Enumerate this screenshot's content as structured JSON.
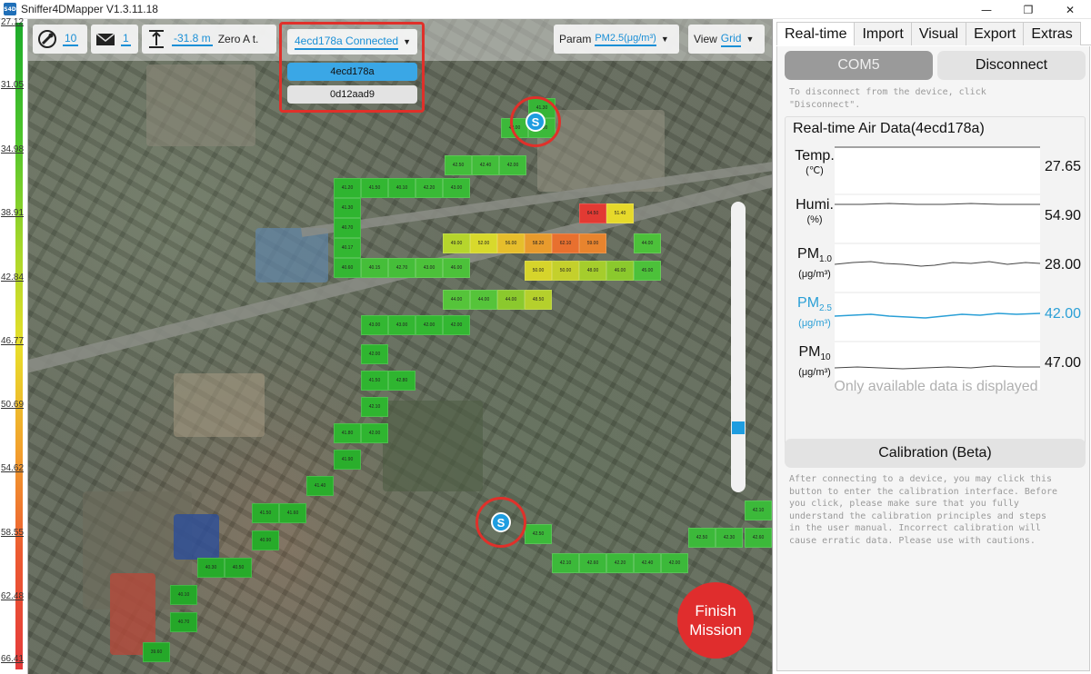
{
  "window": {
    "title": "Sniffer4DMapper V1.3.11.18",
    "icon_text": "S4D",
    "min": "—",
    "max": "❐",
    "close": "✕"
  },
  "scale": {
    "labels": [
      "27.12",
      "31.05",
      "34.98",
      "38.91",
      "42.84",
      "46.77",
      "50.69",
      "54.62",
      "58.55",
      "62.48",
      "66.41"
    ]
  },
  "toolbar": {
    "satellites": "10",
    "messages": "1",
    "altitude": "-31.8 m",
    "zero_label": "Zero A t.",
    "device_selected": "4ecd178a Connected",
    "device_options": [
      "4ecd178a",
      "0d12aad9"
    ],
    "param_label": "Param",
    "param_value": "PM2.5(μg/m³)",
    "view_label": "View",
    "view_value": "Grid"
  },
  "markers": [
    "S",
    "S"
  ],
  "finish_button": "Finish Mission",
  "panel": {
    "tabs": [
      "Real-time",
      "Import",
      "Visual",
      "Export",
      "Extras"
    ],
    "active_tab": "Real-time",
    "port_button": "COM5",
    "disconnect_button": "Disconnect",
    "disconnect_hint": [
      "To disconnect from the device, click",
      "\"Disconnect\"."
    ],
    "air_title": "Real-time Air Data(4ecd178a)",
    "rows": [
      {
        "label": "Temp.",
        "unit": "(℃)",
        "value": "27.65"
      },
      {
        "label": "Humi.",
        "unit": "(%)",
        "value": "54.90"
      },
      {
        "label": "PM",
        "sub": "1.0",
        "unit": "(μg/m³)",
        "value": "28.00"
      },
      {
        "label": "PM",
        "sub": "2.5",
        "unit": "(μg/m³)",
        "value": "42.00"
      },
      {
        "label": "PM",
        "sub": "10",
        "unit": "(μg/m³)",
        "value": "47.00"
      }
    ],
    "footnote": "Only available data is displayed",
    "calibration_button": "Calibration (Beta)",
    "calibration_hint": [
      "After connecting to a device, you may click this",
      "button to enter the calibration interface. Before",
      "you click, please make sure that you fully",
      "understand the calibration principles and steps",
      "in the user manual. Incorrect calibration will",
      "cause erratic data. Please use with cautions."
    ]
  },
  "colors": {
    "accent": "#1a8fd6",
    "alert": "#e0302a",
    "cell_green": "#2fb82f",
    "cell_yellow": "#e7d92c",
    "cell_red": "#e53b3b"
  }
}
